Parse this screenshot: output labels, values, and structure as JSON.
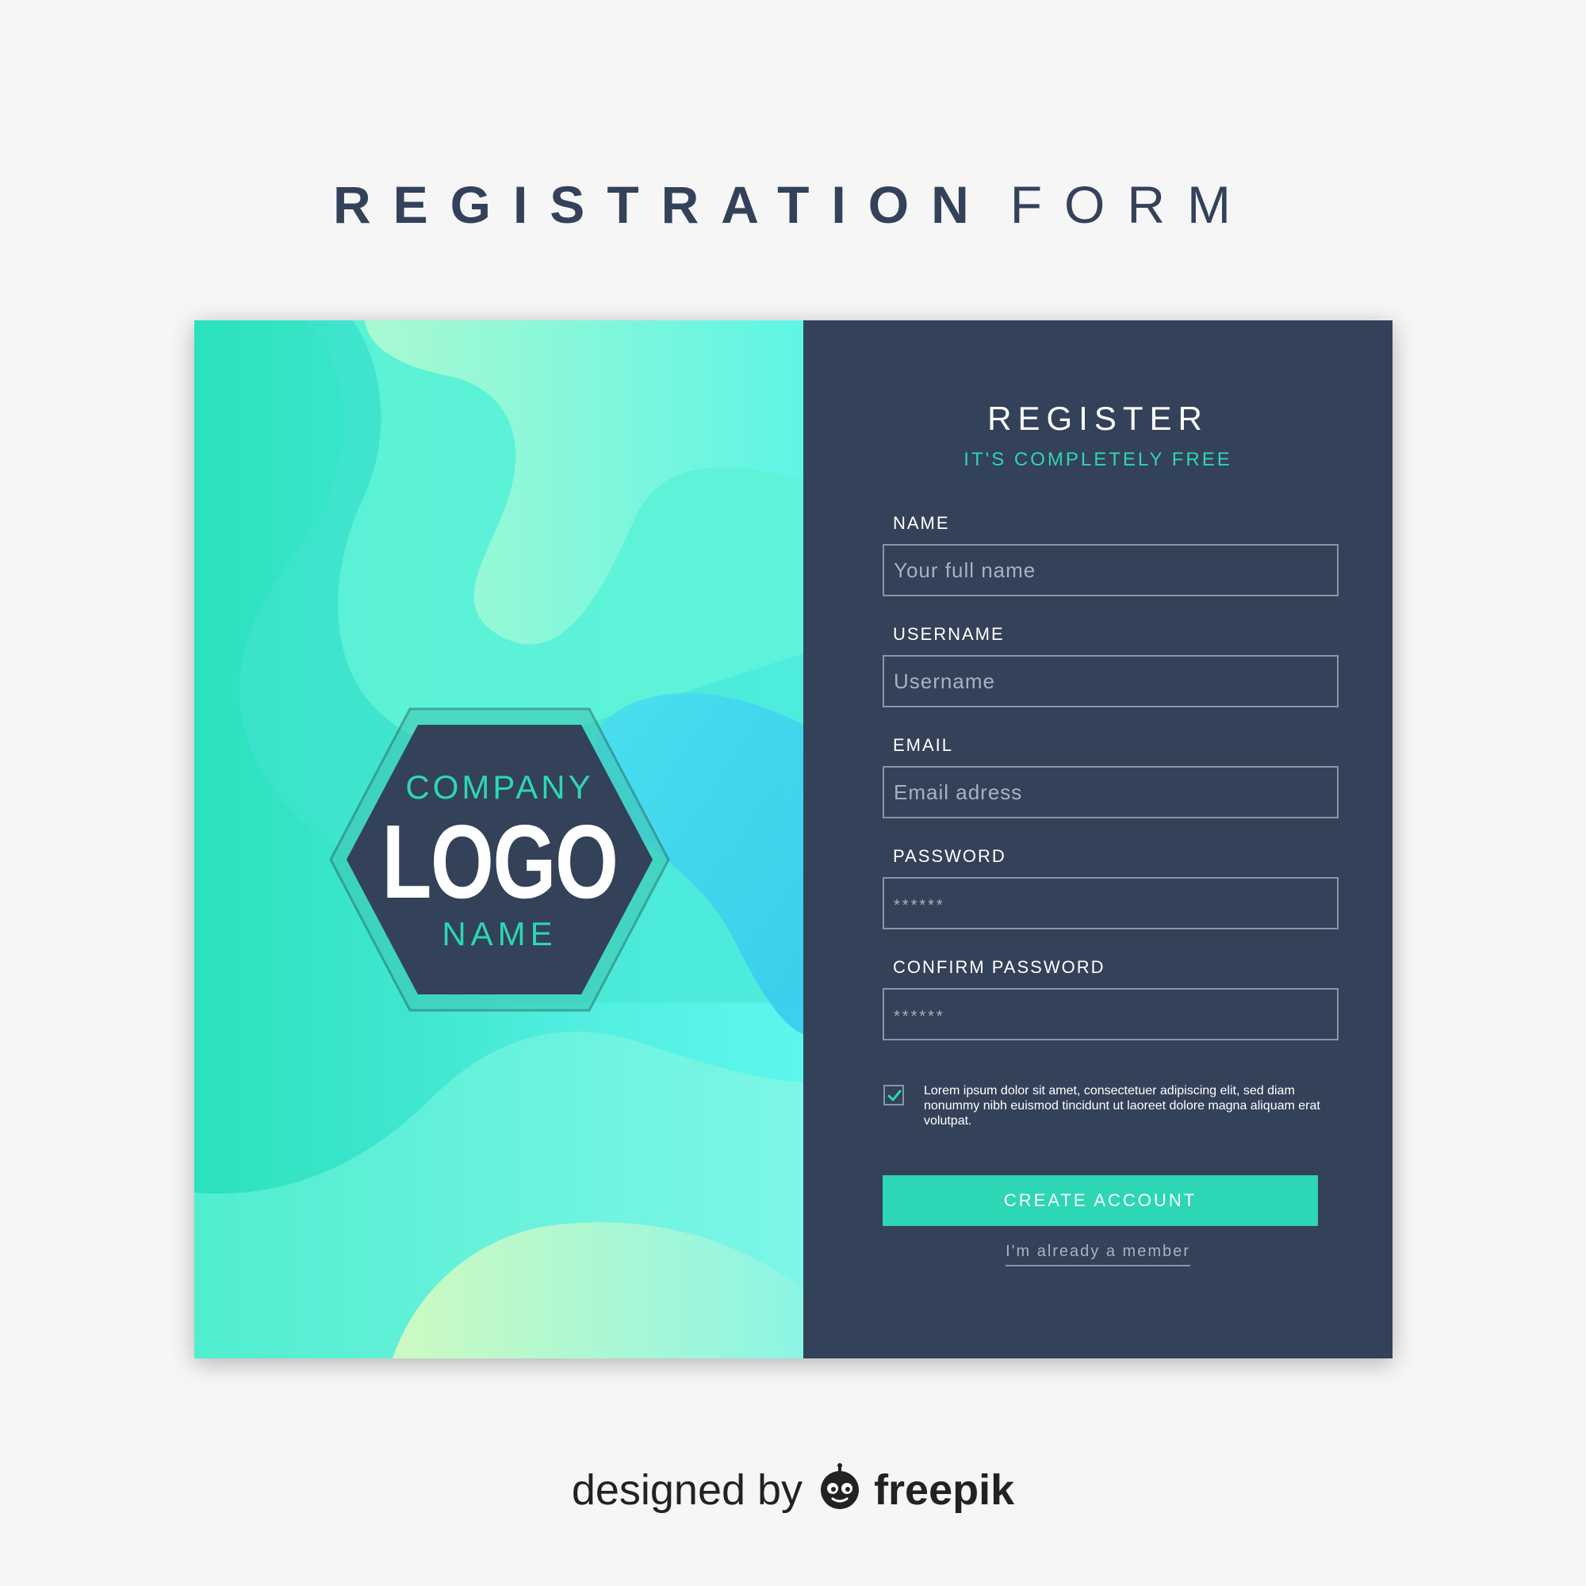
{
  "heading": {
    "bold": "REGISTRATION",
    "light": "FORM"
  },
  "logo": {
    "line1": "COMPANY",
    "line2": "LOGO",
    "line3": "NAME"
  },
  "form": {
    "title": "REGISTER",
    "subtitle": "IT'S COMPLETELY FREE",
    "fields": [
      {
        "label": "NAME",
        "placeholder": "Your full name",
        "value": ""
      },
      {
        "label": "USERNAME",
        "placeholder": "Username",
        "value": ""
      },
      {
        "label": "EMAIL",
        "placeholder": "Email adress",
        "value": ""
      },
      {
        "label": "PASSWORD",
        "placeholder": "******",
        "value": ""
      },
      {
        "label": "CONFIRM PASSWORD",
        "placeholder": "******",
        "value": ""
      }
    ],
    "terms_checked": true,
    "terms_text": "Lorem ipsum dolor sit amet, consectetuer adipiscing elit, sed diam nonummy nibh euismod tincidunt ut laoreet dolore magna aliquam erat volutpat.",
    "submit_label": "CREATE ACCOUNT",
    "member_link": "I'm already a member"
  },
  "credit": {
    "prefix": "designed by",
    "brand": "freepik"
  },
  "colors": {
    "accent": "#2dd6b5",
    "panel": "#334159",
    "background": "#f6f6f6",
    "gradient_start": "#2ae2bb",
    "gradient_end": "#5cf6ee"
  },
  "icons": {
    "check": "check-icon",
    "brand_mascot": "freepik-mascot-icon"
  }
}
